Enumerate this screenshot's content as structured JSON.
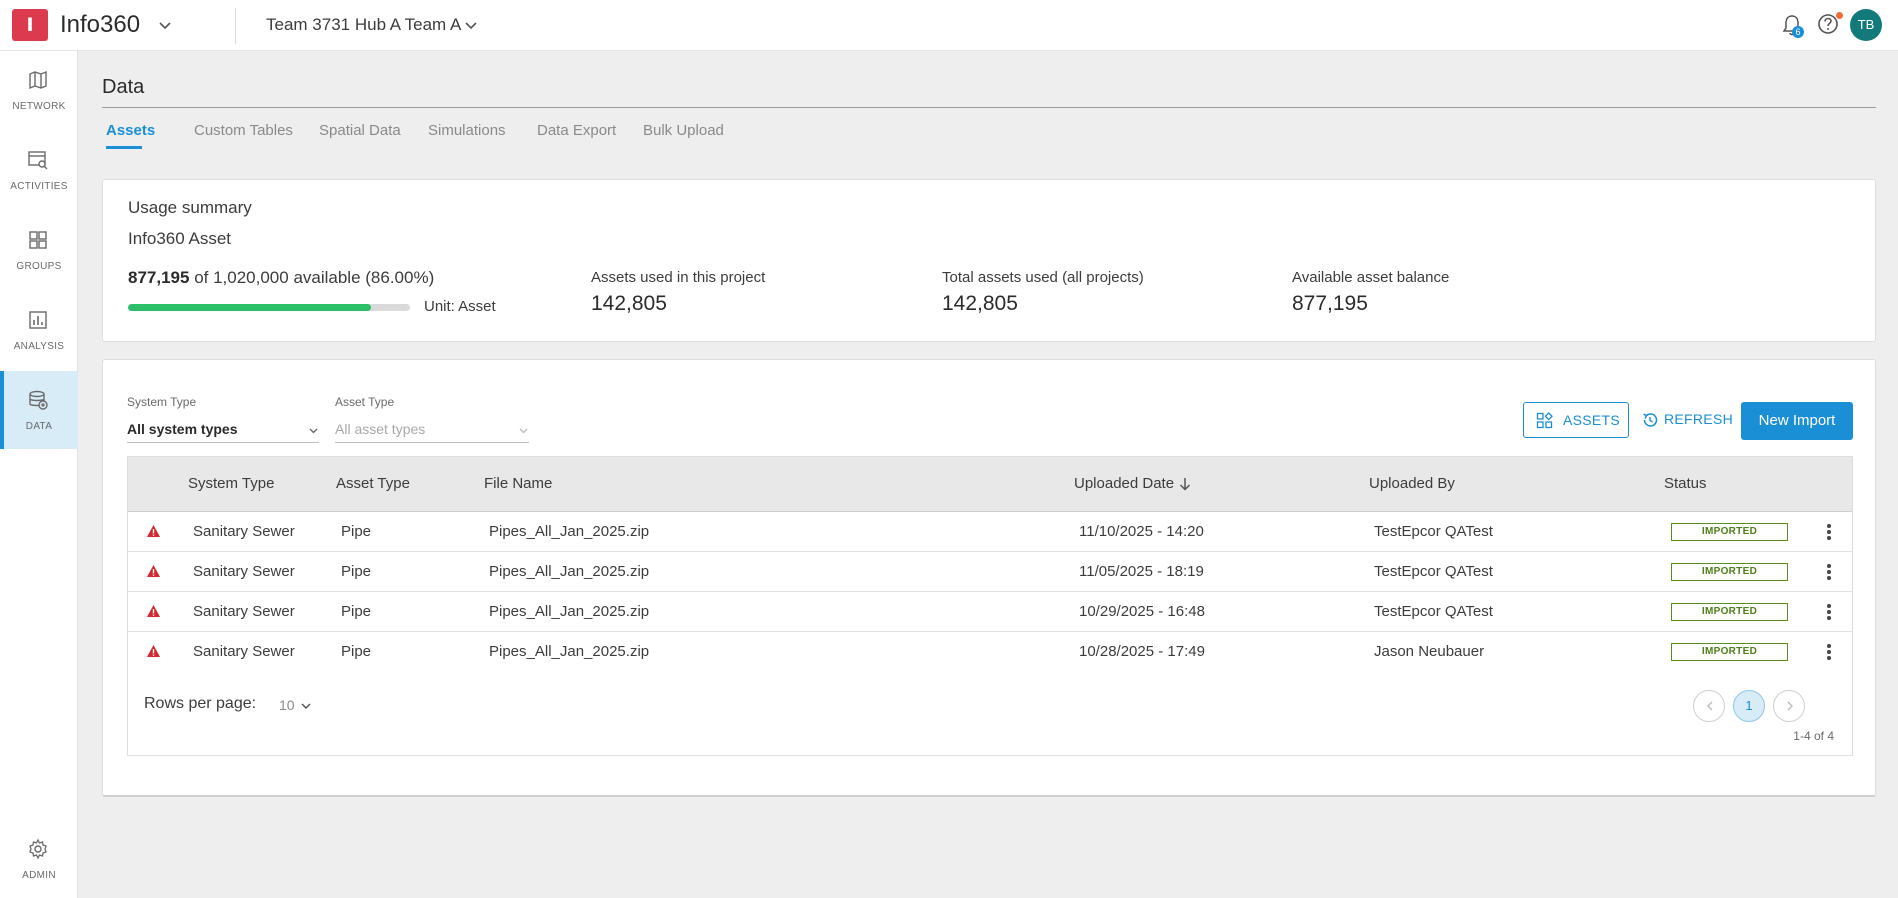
{
  "app": {
    "logo_letter": "I",
    "title": "Info360",
    "hub_name": "Team 3731 Hub A Team A",
    "notification_count": "6",
    "user_initials": "TB",
    "accent_color": "#1a8fd6",
    "brand_color": "#dc3b4f"
  },
  "sidebar": {
    "items": [
      {
        "label": "NETWORK",
        "icon": "map-icon"
      },
      {
        "label": "ACTIVITIES",
        "icon": "activities-icon"
      },
      {
        "label": "GROUPS",
        "icon": "groups-icon"
      },
      {
        "label": "ANALYSIS",
        "icon": "analysis-icon"
      },
      {
        "label": "DATA",
        "icon": "database-icon",
        "active": true
      }
    ],
    "admin": {
      "label": "ADMIN",
      "icon": "gear-icon"
    }
  },
  "page": {
    "title": "Data",
    "tabs": [
      {
        "label": "Assets",
        "active": true
      },
      {
        "label": "Custom Tables"
      },
      {
        "label": "Spatial Data"
      },
      {
        "label": "Simulations"
      },
      {
        "label": "Data Export"
      },
      {
        "label": "Bulk Upload"
      }
    ]
  },
  "usage": {
    "heading": "Usage summary",
    "subheading": "Info360 Asset",
    "available_value": "877,195",
    "available_text": "of 1,020,000 available (86.00%)",
    "available_fraction": 0.86,
    "unit_label": "Unit: Asset",
    "stats": [
      {
        "label": "Assets used in this project",
        "value": "142,805"
      },
      {
        "label": "Total assets used (all projects)",
        "value": "142,805"
      },
      {
        "label": "Available asset balance",
        "value": "877,195"
      }
    ]
  },
  "filters": {
    "system_type": {
      "label": "System Type",
      "value": "All system types"
    },
    "asset_type": {
      "label": "Asset Type",
      "placeholder": "All asset types"
    }
  },
  "actions": {
    "assets_label": "ASSETS",
    "refresh_label": "REFRESH",
    "new_import_label": "New Import"
  },
  "table": {
    "columns": [
      "System Type",
      "Asset Type",
      "File Name",
      "Uploaded Date",
      "Uploaded By",
      "Status"
    ],
    "rows": [
      {
        "system_type": "Sanitary Sewer",
        "asset_type": "Pipe",
        "file_name": "Pipes_All_Jan_2025.zip",
        "uploaded_date": "11/10/2025 - 14:20",
        "uploaded_by": "TestEpcor QATest",
        "status": "IMPORTED"
      },
      {
        "system_type": "Sanitary Sewer",
        "asset_type": "Pipe",
        "file_name": "Pipes_All_Jan_2025.zip",
        "uploaded_date": "11/05/2025 - 18:19",
        "uploaded_by": "TestEpcor QATest",
        "status": "IMPORTED"
      },
      {
        "system_type": "Sanitary Sewer",
        "asset_type": "Pipe",
        "file_name": "Pipes_All_Jan_2025.zip",
        "uploaded_date": "10/29/2025 - 16:48",
        "uploaded_by": "TestEpcor QATest",
        "status": "IMPORTED"
      },
      {
        "system_type": "Sanitary Sewer",
        "asset_type": "Pipe",
        "file_name": "Pipes_All_Jan_2025.zip",
        "uploaded_date": "10/28/2025 - 17:49",
        "uploaded_by": "Jason Neubauer",
        "status": "IMPORTED"
      }
    ],
    "status_color": "#5a8f1f",
    "warning_color": "#d9262c"
  },
  "pagination": {
    "rows_per_page_label": "Rows per page:",
    "rows_per_page_value": "10",
    "current_page": "1",
    "range_text": "1-4 of 4"
  }
}
